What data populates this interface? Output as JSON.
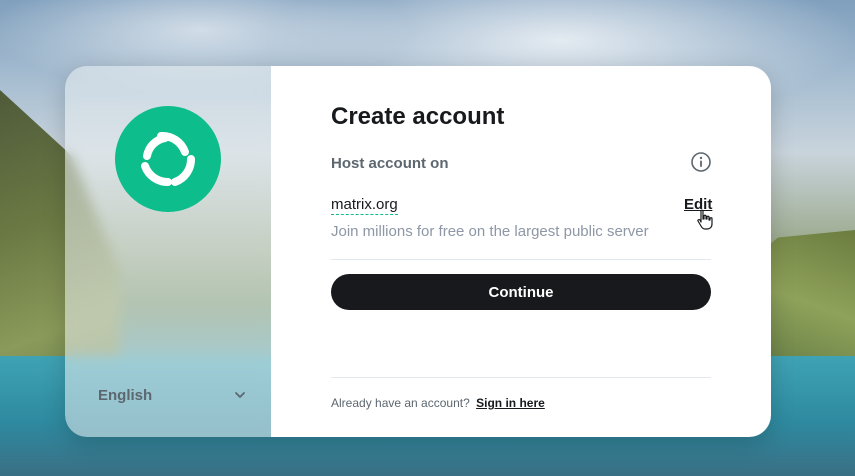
{
  "branding": {
    "logo_icon": "element-logo-icon",
    "accent_color": "#0dbd8b"
  },
  "language": {
    "selected": "English",
    "icon": "chevron-down-icon"
  },
  "form": {
    "title": "Create account",
    "host_label": "Host account on",
    "info_icon": "info-icon",
    "server_name": "matrix.org",
    "edit_label": "Edit",
    "server_description": "Join millions for free on the largest public server",
    "continue_label": "Continue"
  },
  "footer": {
    "prompt": "Already have an account?",
    "sign_in_label": "Sign in here"
  }
}
